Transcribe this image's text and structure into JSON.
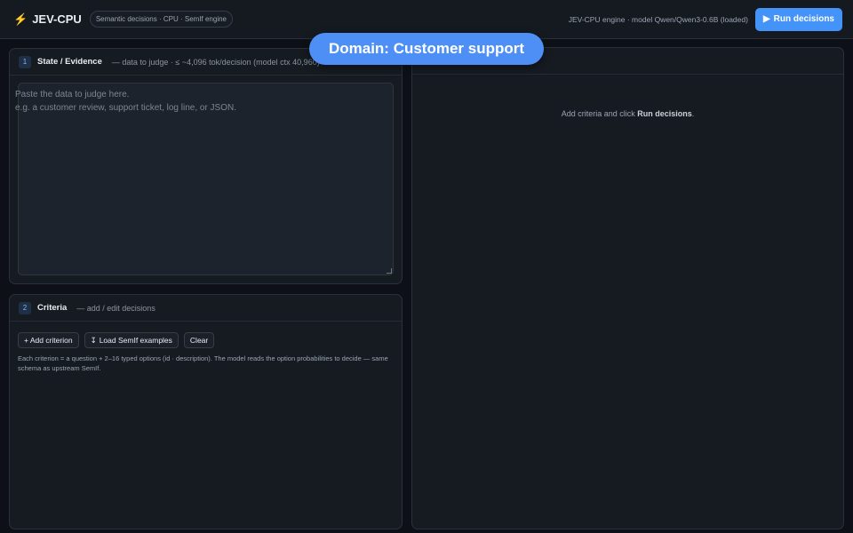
{
  "header": {
    "brand_icon": "bolt-icon",
    "brand": "JEV-CPU",
    "pill": "Semantic decisions · CPU · SemIf engine",
    "engine_status": "JEV-CPU engine · model Qwen/Qwen3-0.6B (loaded)",
    "run_icon": "▶",
    "run_label": "Run decisions"
  },
  "state_panel": {
    "step": "1",
    "title": "State / Evidence",
    "subtitle": "— data to judge · ≤ ~4,096 tok/decision (model ctx 40,960)",
    "textarea_value": "",
    "placeholder_line1": "Paste the data to judge here.",
    "placeholder_line2": "e.g. a customer review, support ticket, log line, or JSON."
  },
  "criteria_panel": {
    "step": "2",
    "title": "Criteria",
    "subtitle": "— add / edit decisions",
    "add_label": "+ Add criterion",
    "load_icon": "↧",
    "load_label": "Load SemIf examples",
    "clear_label": "Clear",
    "help": "Each criterion = a question + 2–16 typed options (id · description). The model reads the option probabilities to decide — same schema as upstream SemIf."
  },
  "results_panel": {
    "empty_prefix": "Add criteria and click ",
    "empty_bold": "Run decisions",
    "empty_suffix": "."
  },
  "toast": {
    "text": "Domain: Customer support"
  },
  "colors": {
    "accent": "#4493f8",
    "toast": "#4d8ff5",
    "background": "#0d1117",
    "panel": "#161b22"
  }
}
